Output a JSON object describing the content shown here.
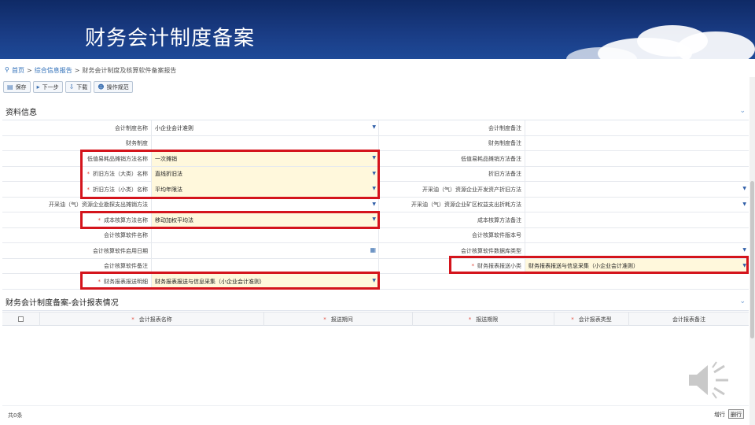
{
  "slide_title": "财务会计制度备案",
  "breadcrumb": {
    "home": "首页",
    "section": "综合信息报告",
    "current": "财务会计制度及核算软件备案报告"
  },
  "toolbar": {
    "save": "保存",
    "next": "下一步",
    "download": "下载",
    "guide": "操作规范"
  },
  "section1": {
    "title": "资料信息"
  },
  "form_rows": [
    {
      "l1": "会计制度名称",
      "v1": "小企业会计准则",
      "l2": "会计制度备注",
      "v2": ""
    },
    {
      "l1": "财务制度",
      "v1": "",
      "l2": "财务制度备注",
      "v2": ""
    },
    {
      "l1": "低值易耗品摊销方法名称",
      "v1": "一次摊销",
      "l2": "低值易耗品摊销方法备注",
      "v2": ""
    },
    {
      "l1": "折旧方法（大类）名称",
      "v1": "直线折旧法",
      "l2": "折旧方法备注",
      "v2": ""
    },
    {
      "l1": "折旧方法（小类）名称",
      "v1": "平均年限法",
      "l2": "开采油（气）资源企业开发资产折旧方法",
      "v2": ""
    },
    {
      "l1": "开采油（气）资源企业勘探支出摊销方法",
      "v1": "",
      "l2": "开采油（气）资源企业矿区权益支出折耗方法",
      "v2": ""
    },
    {
      "l1": "成本核算方法名称",
      "v1": "移动加权平均法",
      "l2": "成本核算方法备注",
      "v2": ""
    },
    {
      "l1": "会计核算软件名称",
      "v1": "",
      "l2": "会计核算软件版本号",
      "v2": ""
    },
    {
      "l1": "会计核算软件启用日期",
      "v1": "",
      "l2": "会计核算软件数据库类型",
      "v2": ""
    },
    {
      "l1": "会计核算软件备注",
      "v1": "",
      "l2": "财务报表报送小类",
      "v2": "财务报表报送与信息采集（小企业会计准则）"
    },
    {
      "l1": "财务报表报送明细",
      "v1": "财务报表报送与信息采集（小企业会计准则）",
      "l2": "",
      "v2": ""
    }
  ],
  "section2": {
    "title": "财务会计制度备案-会计报表情况",
    "columns": [
      "会计报表名称",
      "报送期间",
      "报送期限",
      "会计报表类型",
      "会计报表备注"
    ],
    "count_label": "共0条",
    "add_row": "增行",
    "delete_row": "删行"
  }
}
